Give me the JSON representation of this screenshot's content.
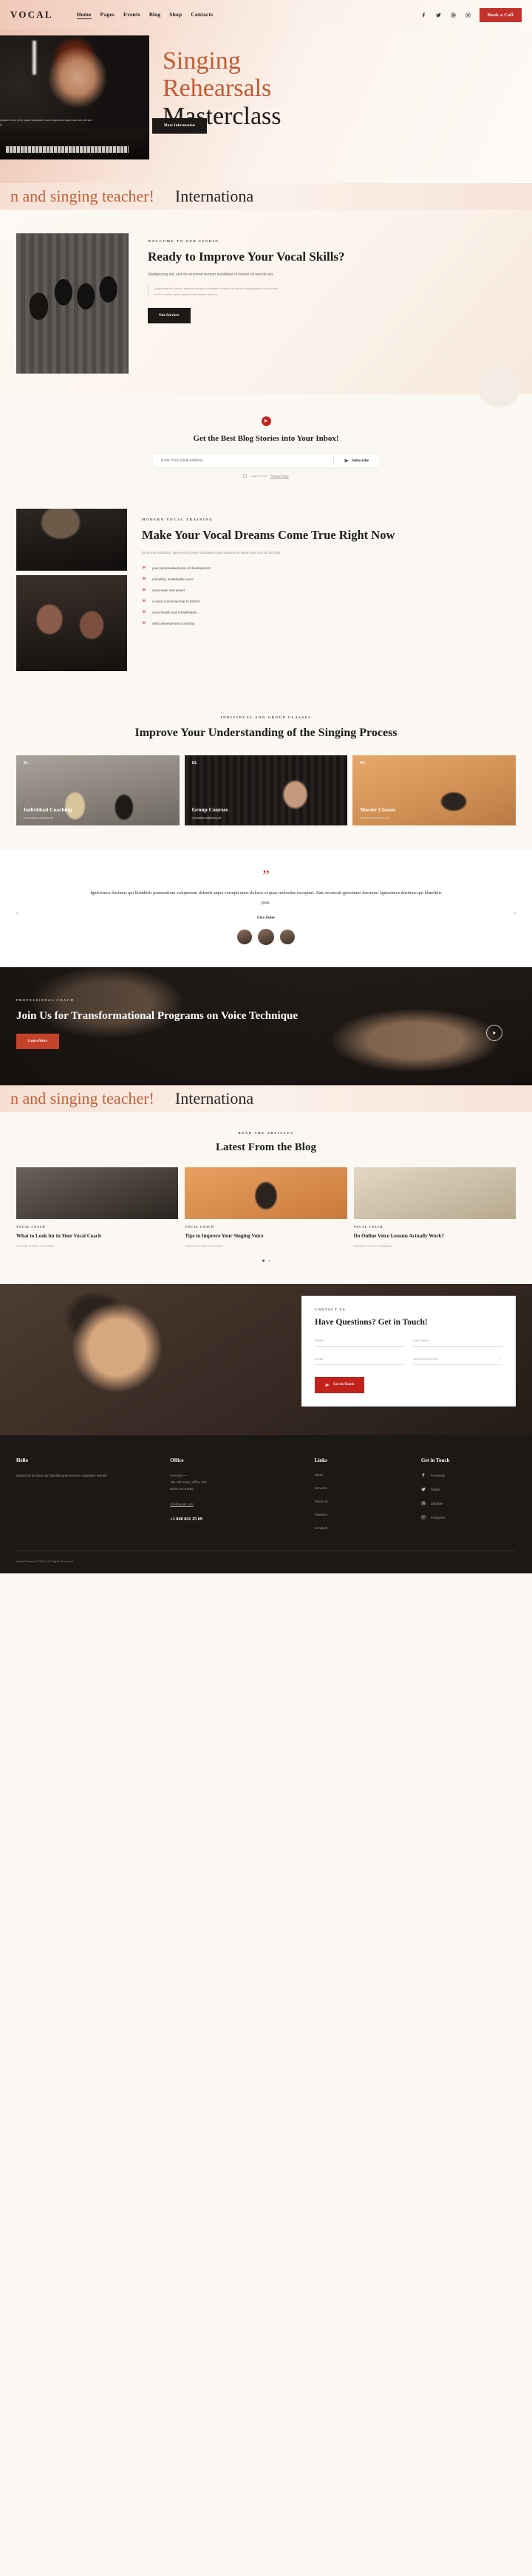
{
  "header": {
    "logo": "VOCAL",
    "nav": [
      {
        "label": "Home",
        "active": true
      },
      {
        "label": "Pages",
        "active": false
      },
      {
        "label": "Events",
        "active": false
      },
      {
        "label": "Blog",
        "active": false
      },
      {
        "label": "Shop",
        "active": false
      },
      {
        "label": "Contacts",
        "active": false
      }
    ],
    "socials": [
      "facebook-icon",
      "twitter-icon",
      "dribbble-icon",
      "instagram-icon"
    ],
    "cta": "Book a Call",
    "accent": "#c2312a"
  },
  "hero": {
    "line1": "Singing",
    "line2": "Rehearsals",
    "line3": "Masterclass",
    "note": "Dicta sunt explicabo nemo enim ipsam voluptatem quia voluptas sit aspernatur aut odit aut fugit, sed quia.",
    "button": "More Information"
  },
  "marquee": {
    "item1": "n and singing teacher!",
    "item2": "Internationa"
  },
  "ready": {
    "eyebrow": "WELCOME TO OUR STUDIO",
    "title": "Ready to Improve Your Vocal Skills?",
    "lead": "Qadipiscing elit, sed do eiusmod tempor incididunt ut labore eli sed do eiu.",
    "quote": "Adipiscing elit, sed do eiusmod tempor incididunt ut labore et dolore magna aliqua. Ut enim ad minim veniam, quis nostrud exercitation ullamco.",
    "button": "Our Services"
  },
  "newsletter": {
    "title": "Get the Best Blog Stories into Your Inbox!",
    "placeholder": "Enter Your Email Address",
    "submit": "Subscribe",
    "agree_pre": "I agree to the",
    "agree_link": "Privacy Policy"
  },
  "dreams": {
    "eyebrow": "MODERN VOCAL TRAINING",
    "title": "Make Your Vocal Dreams Come True Right Now",
    "text": "Dicta sunt explicabo. Nemo enim ipsam voluptatem quia voluptas sit aspernatur aut odit aut fugit.",
    "features": [
      "your personalised plan of development",
      "a healthy, sustainable voice",
      "vocal ease and power",
      "a voice connected top to bottom",
      "vocal health and rehabilitation",
      "artist development coaching"
    ]
  },
  "classes": {
    "eyebrow": "INDIVIDUAL AND GROUP CLASSES",
    "title": "Improve Your Understanding of the Singing Process",
    "cards": [
      {
        "num": "01.",
        "title": "Individual Coaching",
        "desc": "Consectetur adipiscing elit"
      },
      {
        "num": "02.",
        "title": "Group Courses",
        "desc": "Consectetur adipiscing elit"
      },
      {
        "num": "03.",
        "title": "Master Classes",
        "desc": "Consectetur adipiscing elit"
      }
    ]
  },
  "testimonial": {
    "quote": "Ignissimos ducimus qui blanditiis praesentium voluptatum deleniti atque corrupti quos dolores et quas molestias excepturi. Sint occaecati gnissimos ducimus. Ignissimos ducimus qui blanditiis prae.",
    "name": "Lisa Jones",
    "prev": "←",
    "next": "→"
  },
  "join": {
    "eyebrow": "PROFESSIONAL COACH",
    "title": "Join Us for Transformational Programs on Voice Technique",
    "button": "Learn More"
  },
  "blog": {
    "eyebrow": "READ THE ARTICLES",
    "title": "Latest From the Blog",
    "posts": [
      {
        "cat": "VOCAL COACH",
        "title": "What to Look for in Your Vocal Coach",
        "meta": "December 21 2023   •   0 Comments"
      },
      {
        "cat": "VOCAL COACH",
        "title": "Tips to Improve Your Singing Voice",
        "meta": "December 21 2023   •   0 Comments"
      },
      {
        "cat": "VOCAL COACH",
        "title": "Do Online Voice Lessons Actually Work?",
        "meta": "December 21 2023   •   0 Comments"
      }
    ]
  },
  "contact": {
    "eyebrow": "CONTACT US",
    "title": "Have Questions? Get in Touch!",
    "fields": {
      "name": "Name",
      "last_name": "Last Name",
      "email": "Email",
      "residence": "Select Residence"
    },
    "button": "Get In Touch"
  },
  "footer": {
    "hello_title": "Hello",
    "hello_text": "Ignissimos ducimus qui blanditiis prae sentium voluptatum deleniti.",
    "office_title": "Office",
    "office_lines": [
      "Germany —",
      "785 15h Street, Office 478",
      "Berlin, De 81566"
    ],
    "email": "info@email.com",
    "phone": "+1 840 841 25 69",
    "links_title": "Links",
    "links": [
      "Home",
      "Services",
      "About Us",
      "Features",
      "Contacts"
    ],
    "touch_title": "Get in Touch",
    "socials": [
      "Facebook",
      "Twitter",
      "Dribbble",
      "Instagram"
    ],
    "copyright": "AxiomThemes © 2023. All Rights Reserved."
  }
}
